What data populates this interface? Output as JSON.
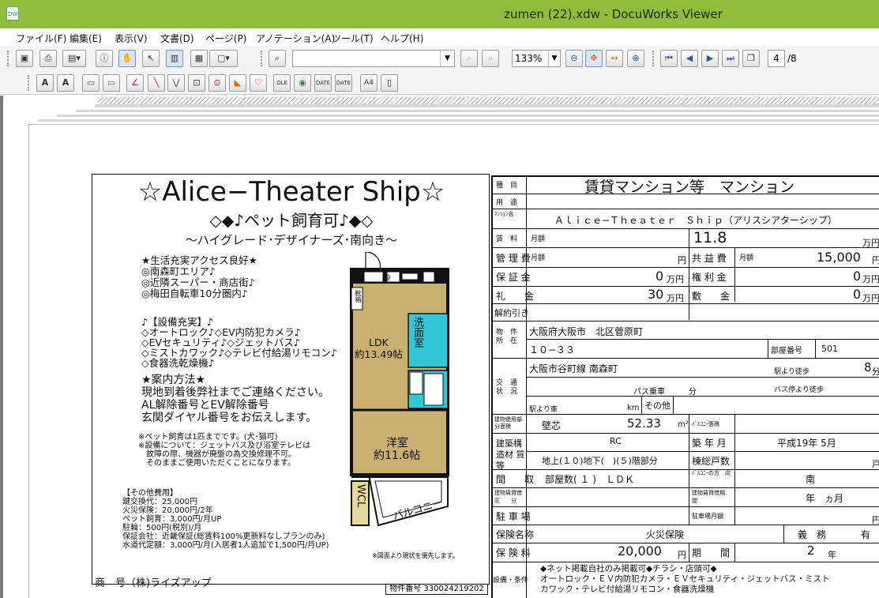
{
  "window": {
    "title": "zumen (22).xdw - DocuWorks Viewer",
    "app_icon": "DW"
  },
  "menu": [
    "ファイル(F)",
    "編集(E)",
    "表示(V)",
    "文書(D)",
    "ページ(P)",
    "アノテーション(A)",
    "ツール(T)",
    "ヘルプ(H)"
  ],
  "toolbar": {
    "zoom": "133%",
    "page_current": "4",
    "page_total": "/8"
  },
  "flyer": {
    "title": "☆Alice−Theater Ship☆",
    "subtitle": "◇◆♪ペット飼育可♪◆◇",
    "tagline": "〜ハイグレード･デザイナーズ･南向き〜",
    "points": [
      "★生活充実アクセス良好★",
      "◎南森町エリア♪",
      "◎近隣スーパー・商店街♪",
      "◎梅田自転車10分圏内♪"
    ],
    "facilities": [
      "♪【設備充実】♪",
      "◇オートロック♪◇EV内防犯カメラ♪",
      "◇EVセキュリティ♪◇ジェットバス♪",
      "◇ミストカワック♪◇テレビ付給湯リモコン♪",
      "◇食器洗乾燥機♪"
    ],
    "guide": [
      "★案内方法★",
      "現地到着後弊社までご連絡ください。",
      "AL解除番号とEV解除番号",
      "玄関ダイヤル番号をお伝えします。"
    ],
    "notes": [
      "※ペット飼育は1匹までです。(犬･猫可)",
      "※設備について：ジェットバス及び浴室テレビは",
      "　故障の際、機器が廃盤の為交換修理不可。",
      "　そのままご使用いただくことになります。"
    ],
    "costs": [
      "【その他費用】",
      "鍵交換代：25,000円",
      "火災保険：20,000円/2年",
      "ペット飼育：3,000円/月UP",
      "駐輪：500円(税別)/月",
      "保証会社：近畿保証(総賃料100%更新料なしプランのみ)",
      "水道代定額：3,000円/月(入居者1人追加で1,500円/月UP)"
    ],
    "priority_note": "※図面より現状を優先します。",
    "bukken_no": "物件番号 330024219202",
    "shogo": "商　号（株)ライズアップ",
    "floorplan": {
      "genkan": "玄関",
      "rei": "冷",
      "senmen": "洗面室",
      "ldk": "LDK",
      "ldk_size": "約13.49帖",
      "yoshitsu": "洋室",
      "yoshitsu_size": "約11.6帖",
      "wcl": "WCL",
      "balcony": "バルコニー",
      "shuno": "靴箱"
    }
  },
  "spec": {
    "shumoku_label": "種　目",
    "shumoku_value": "賃貸マンション等　マンション",
    "yoto_label": "用　途",
    "mansion_label": "ﾏﾝｼｮﾝ名",
    "mansion_value": "Ａｌｉｃｅ−Ｔｈｅａｔｅｒ　Ｓｈｉｐ（アリスシアターシップ）",
    "chinryo_label": "賃　料",
    "getsugaku": "月額",
    "chinryo_value": "11.8",
    "man_yen": "万円",
    "kanri_label": "管 理 費",
    "yen": "円",
    "kyoeki_label": "共 益 費",
    "kyoeki_value": "15,000",
    "hosho_label": "保 証 金",
    "hosho_value": "0",
    "kenri_label": "権 利 金",
    "kenri_value": "0",
    "rei_label": "礼　　金",
    "rei_value": "30",
    "shiki_label": "敷　　金",
    "shiki_value": "0",
    "kaiyaku_label": "解約引き",
    "bukken_label": "物　件所　在",
    "address1": "大阪府大阪市　北区菅原町",
    "address2": "１０−３３",
    "heya_label": "部屋番号",
    "heya_value": "501",
    "kotsu_label": "交　通状　況",
    "line_station": "大阪市谷町線 南森町",
    "eki_walk": "駅より徒歩",
    "walk_value": "8",
    "walk_unit": "分",
    "bus_josha": "バス乗車",
    "bus_min": "分",
    "bus_walk": "バス停より徒歩",
    "eki_kuruma": "駅より車",
    "km": "km",
    "sonota": "その他",
    "menseki_label": "建物使用部分面積",
    "kabeshin": "壁芯",
    "menseki_value": "52.33",
    "m2": "m²",
    "balcony_area_label": "ﾊﾞﾙｺﾆｰ面積",
    "kozo_label": "建築構造材 質 等",
    "kozo_value": "RC",
    "chikunen_label": "築 年 月",
    "chikunen_value": "平成19年 5月",
    "floors": "地上(１０)地下(　)(５)階部分",
    "sokosu_label": "棟総戸数",
    "sokosu_unit": "戸",
    "madori_label": "間　　取",
    "madori_value": "部屋数( １ )　ＬＤＫ",
    "balcony_dir_label": "ﾊﾞﾙｺﾆｰの方　向",
    "balcony_dir_value": "南",
    "tatemono_kubun_label": "建物賃貸借区　　分",
    "tatemono_kikan_label": "建物賃貸借期　　間",
    "kikan_value": "年　ヵ月",
    "chushajo_label": "駐 車 場",
    "chushajo_getsugaku_label": "駐車場月額",
    "hoken_name_label": "保険名称",
    "hoken_name_value": "火災保険",
    "gimu": "義　務",
    "ari": "有",
    "hokenryo_label": "保 険 料",
    "hokenryo_value": "20,000",
    "kikan_label": "期　　間",
    "hoken_kikan_value": "2",
    "nen": "年",
    "setsubi_label": "設備・条件",
    "setsubi_lines": [
      "◆ネット掲載自社のみ掲載可◆チラシ・店頭可◆",
      "オートロック・ＥＶ内防犯カメラ・ＥＶセキュリティ・ジェットバス・ミスト",
      "カワック・テレビ付給湯リモコン・食器洗燥機"
    ]
  }
}
